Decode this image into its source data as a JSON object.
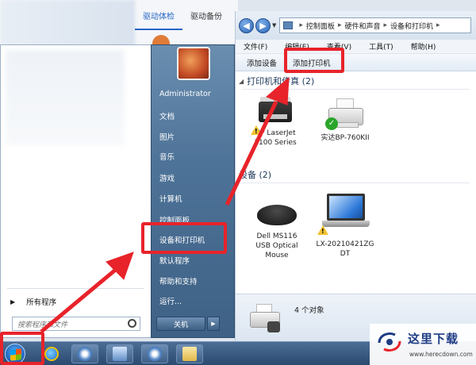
{
  "background_app": {
    "tabs": [
      {
        "label": "驱动体检",
        "active": true
      },
      {
        "label": "驱动备份",
        "active": false
      }
    ]
  },
  "explorer": {
    "address": [
      "控制面板",
      "硬件和声音",
      "设备和打印机"
    ],
    "menu": [
      "文件(F)",
      "编辑(E)",
      "查看(V)",
      "工具(T)",
      "帮助(H)"
    ],
    "toolbar": {
      "add_device": "添加设备",
      "add_printer": "添加打印机"
    },
    "printers_group": {
      "title": "打印机和传真 (2)",
      "items": [
        {
          "name_line1": "HP LaserJet",
          "name_line2": "1100 Series",
          "icon": "laser-printer-icon",
          "status": "warning"
        },
        {
          "name_line1": "实达BP-760KII",
          "name_line2": "",
          "icon": "inkjet-printer-icon",
          "status": "default"
        }
      ]
    },
    "devices_group": {
      "title": "设备 (2)",
      "items": [
        {
          "name_line1": "Dell MS116",
          "name_line2": "USB Optical",
          "name_line3": "Mouse",
          "icon": "mouse-icon"
        },
        {
          "name_line1": "LX-20210421ZG",
          "name_line2": "DT",
          "icon": "laptop-icon",
          "status": "warning"
        }
      ]
    },
    "status": {
      "count_text": "4 个对象"
    }
  },
  "start_menu": {
    "all_programs": "所有程序",
    "search_placeholder": "搜索程序和文件",
    "right_items": [
      {
        "label": "Administrator"
      },
      {
        "label": "文档"
      },
      {
        "label": "图片"
      },
      {
        "label": "音乐"
      },
      {
        "label": "游戏"
      },
      {
        "label": "计算机"
      },
      {
        "label": "控制面板"
      },
      {
        "label": "设备和打印机"
      },
      {
        "label": "默认程序"
      },
      {
        "label": "帮助和支持"
      },
      {
        "label": "运行..."
      }
    ],
    "shutdown": "关机"
  },
  "watermark": {
    "brand": "这里下载",
    "url": "www.herecdown.com"
  },
  "colors": {
    "highlight": "#e8232a",
    "start_panel_right": "#4e7398",
    "taskbar": "#2a4a70"
  }
}
